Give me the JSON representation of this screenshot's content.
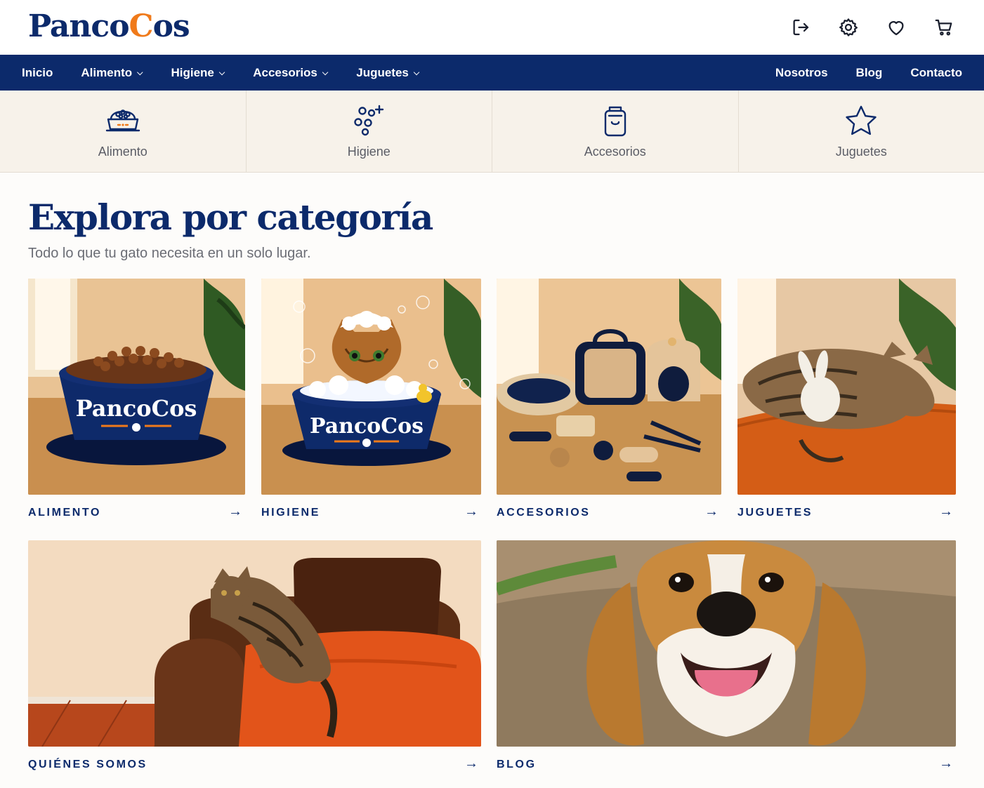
{
  "brand": {
    "name_pre": "Panco",
    "name_cat": "C",
    "name_post": "os"
  },
  "header": {
    "icons": [
      "logout-icon",
      "gear-icon",
      "heart-icon",
      "cart-icon"
    ]
  },
  "nav": {
    "left": [
      {
        "label": "Inicio",
        "dropdown": false
      },
      {
        "label": "Alimento",
        "dropdown": true
      },
      {
        "label": "Higiene",
        "dropdown": true
      },
      {
        "label": "Accesorios",
        "dropdown": true
      },
      {
        "label": "Juguetes",
        "dropdown": true
      }
    ],
    "right": [
      {
        "label": "Nosotros"
      },
      {
        "label": "Blog"
      },
      {
        "label": "Contacto"
      }
    ],
    "chevron": "⌄"
  },
  "strip": [
    {
      "label": "Alimento",
      "icon": "food-bowl-icon"
    },
    {
      "label": "Higiene",
      "icon": "bubbles-icon"
    },
    {
      "label": "Accesorios",
      "icon": "bag-icon"
    },
    {
      "label": "Juguetes",
      "icon": "star-icon"
    }
  ],
  "main": {
    "title": "Explora por categoría",
    "subtitle": "Todo lo que tu gato necesita en un solo lugar."
  },
  "cards": [
    {
      "caption": "ALIMENTO",
      "image": "food-bowl-photo",
      "bowl_text": "PancoCos"
    },
    {
      "caption": "HIGIENE",
      "image": "cat-bath-photo",
      "bowl_text": "PancoCos"
    },
    {
      "caption": "ACCESORIOS",
      "image": "accessories-photo"
    },
    {
      "caption": "JUGUETES",
      "image": "sleeping-cat-photo"
    },
    {
      "caption": "QUIÉNES SOMOS",
      "image": "cat-on-sofa-photo"
    },
    {
      "caption": "BLOG",
      "image": "beagle-photo"
    }
  ],
  "arrow": "→",
  "colors": {
    "brand_navy": "#0c2a6b",
    "brand_orange": "#f07a1a",
    "strip_bg": "#f7f2ea"
  }
}
